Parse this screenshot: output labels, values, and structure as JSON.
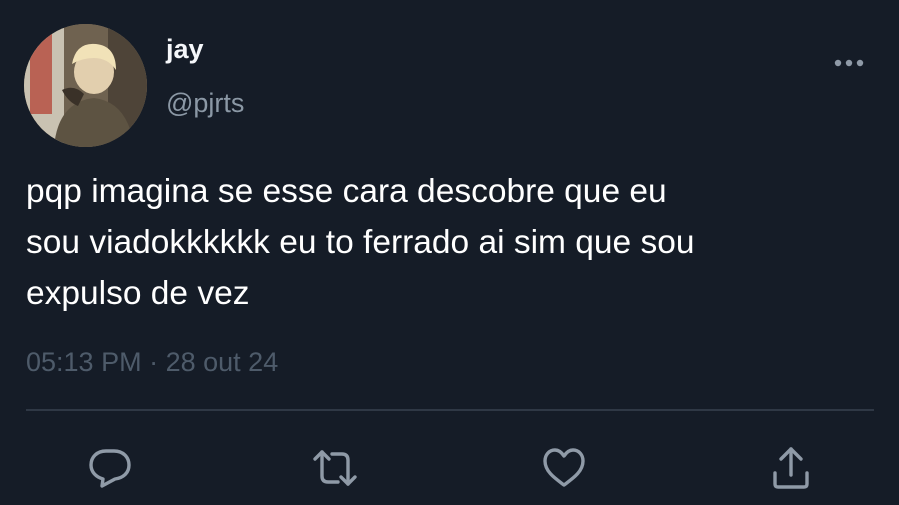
{
  "tweet": {
    "author": {
      "display_name": "jay",
      "handle": "@pjrts",
      "avatar": "profile-photo"
    },
    "text": "pqp imagina se esse cara descobre que eu\nsou viadokkkkkk eu to ferrado ai sim que sou\nexpulso de vez",
    "time": "05:13 PM",
    "separator": "·",
    "date": "28 out 24"
  },
  "actions": {
    "more": "more-icon",
    "reply": "reply-icon",
    "retweet": "retweet-icon",
    "like": "heart-icon",
    "share": "share-icon"
  },
  "colors": {
    "background": "#151c27",
    "text": "#ffffff",
    "secondary": "#8b98a5",
    "meta": "#4e5b6a",
    "icons": "#8f9aa7",
    "divider": "#2f3845"
  }
}
